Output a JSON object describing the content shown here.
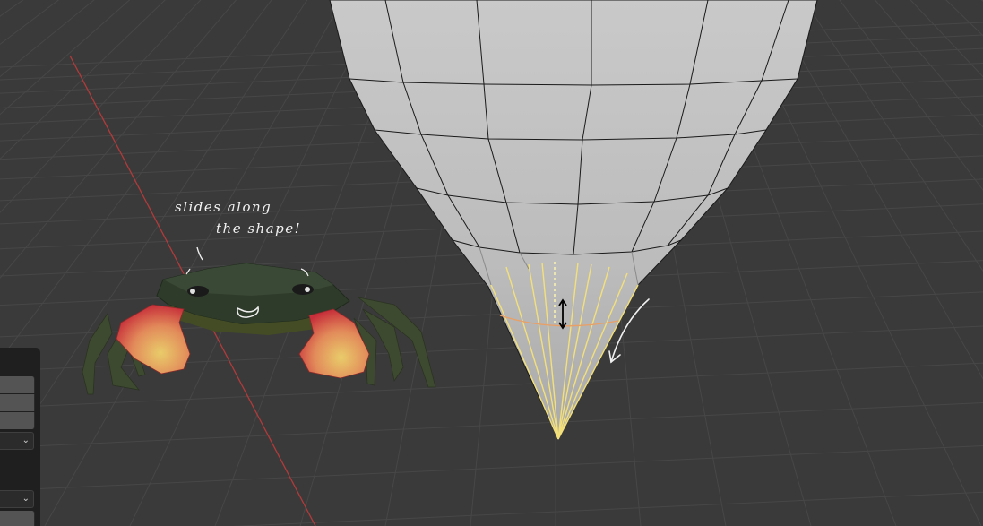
{
  "annotations": {
    "line1": "slides along",
    "line2": "the shape!"
  },
  "colors": {
    "background": "#3a3a3a",
    "grid": "#4a4a4a",
    "x_axis": "#b33a3a",
    "mesh_face": "#c4c4c4",
    "selection": "#f5e27a",
    "panel": "#1f1f1f"
  },
  "side_panel": {
    "dropdown_icon": "chevron-down-icon"
  }
}
